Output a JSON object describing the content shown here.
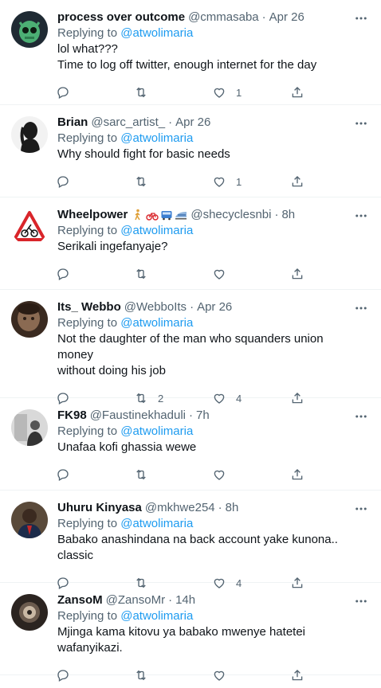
{
  "tweets": [
    {
      "name": "process over outcome",
      "handle": "@cmmasaba",
      "date": "Apr 26",
      "replying_label": "Replying to",
      "replying_to": "@atwolimaria",
      "lines": [
        "lol what???",
        "Time to log off twitter, enough internet for the day"
      ],
      "replies": "",
      "retweets": "",
      "likes": "1",
      "avatar": "green-alien-avatar"
    },
    {
      "name": "Brian",
      "handle": "@sarc_artist_",
      "date": "Apr 26",
      "replying_label": "Replying to",
      "replying_to": "@atwolimaria",
      "lines": [
        "Why should fight for basic needs"
      ],
      "replies": "",
      "retweets": "",
      "likes": "1",
      "avatar": "silhouette-avatar"
    },
    {
      "name": "Wheelpower",
      "emojis": [
        "walking-person-icon",
        "bicycle-icon",
        "bus-icon",
        "train-icon"
      ],
      "handle": "@shecyclesnbi",
      "date": "8h",
      "replying_label": "Replying to",
      "replying_to": "@atwolimaria",
      "lines": [
        "Serikali ingefanyaje?"
      ],
      "replies": "",
      "retweets": "",
      "likes": "",
      "avatar": "warning-sign-avatar"
    },
    {
      "name": "Its_ Webbo",
      "handle": "@WebboIts",
      "date": "Apr 26",
      "replying_label": "Replying to",
      "replying_to": "@atwolimaria",
      "lines": [
        "Not the daughter of the man who squanders union money",
        "without doing his job"
      ],
      "replies": "",
      "retweets": "2",
      "likes": "4",
      "avatar": "photo-avatar"
    },
    {
      "name": "FK98",
      "handle": "@Faustinekhaduli",
      "date": "7h",
      "replying_label": "Replying to",
      "replying_to": "@atwolimaria",
      "lines": [
        "Unafaa kofi ghassia wewe"
      ],
      "replies": "",
      "retweets": "",
      "likes": "",
      "avatar": "photo-avatar"
    },
    {
      "name": "Uhuru Kinyasa",
      "handle": "@mkhwe254",
      "date": "8h",
      "replying_label": "Replying to",
      "replying_to": "@atwolimaria",
      "lines": [
        "Babako anashindana na back account yake kunona.. classic"
      ],
      "replies": "",
      "retweets": "",
      "likes": "4",
      "avatar": "photo-avatar"
    },
    {
      "name": "ZansoM",
      "handle": "@ZansoMr",
      "date": "14h",
      "replying_label": "Replying to",
      "replying_to": "@atwolimaria",
      "lines": [
        "Mjinga kama kitovu ya babako mwenye hatetei wafanyikazi."
      ],
      "replies": "",
      "retweets": "",
      "likes": "",
      "avatar": "photo-avatar"
    }
  ],
  "colors": {
    "link": "#1d9bf0",
    "muted": "#536471",
    "text": "#0f1419",
    "divider": "#eff3f4"
  }
}
